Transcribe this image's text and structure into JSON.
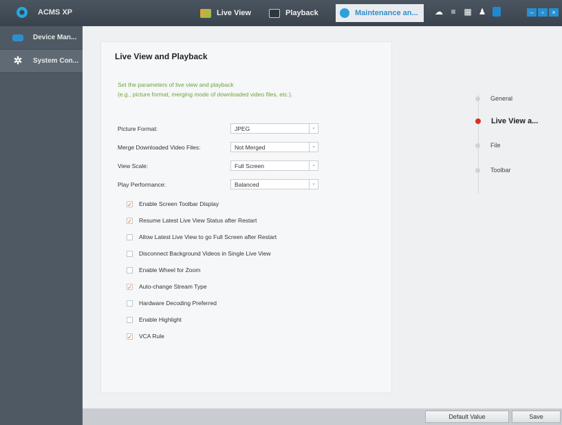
{
  "app": {
    "title": "ACMS XP"
  },
  "nav": {
    "tabs": [
      {
        "label": "Live View",
        "icon": "live-view-icon"
      },
      {
        "label": "Playback",
        "icon": "playback-icon"
      },
      {
        "label": "Maintenance an...",
        "icon": "maintenance-icon",
        "active": true
      }
    ]
  },
  "sidebar": {
    "items": [
      {
        "label": "Device Man...",
        "icon": "device-icon"
      },
      {
        "label": "System Con...",
        "icon": "gear-icon",
        "active": true
      }
    ]
  },
  "panel": {
    "title": "Live View and Playback",
    "description_line1": "Set the parameters of live view and playback",
    "description_line2": "(e.g., picture format, merging mode of downloaded video files, etc.).",
    "fields": [
      {
        "label": "Picture Format:",
        "value": "JPEG"
      },
      {
        "label": "Merge Downloaded Video Files:",
        "value": "Not Merged"
      },
      {
        "label": "View Scale:",
        "value": "Full Screen"
      },
      {
        "label": "Play Performance:",
        "value": "Balanced"
      }
    ],
    "checkboxes": [
      {
        "label": "Enable Screen Toolbar Display",
        "checked": true
      },
      {
        "label": "Resume Latest Live View Status after Restart",
        "checked": true
      },
      {
        "label": "Allow Latest Live View to go Full Screen after Restart",
        "checked": false
      },
      {
        "label": "Disconnect Background Videos in Single Live View",
        "checked": false
      },
      {
        "label": "Enable Wheel for Zoom",
        "checked": false
      },
      {
        "label": "Auto-change Stream Type",
        "checked": true
      },
      {
        "label": "Hardware Decoding Preferred",
        "checked": false
      },
      {
        "label": "Enable Highlight",
        "checked": false
      },
      {
        "label": "VCA Rule",
        "checked": true
      }
    ]
  },
  "steps": [
    {
      "label": "General"
    },
    {
      "label": "Live View a...",
      "active": true
    },
    {
      "label": "File"
    },
    {
      "label": "Toolbar"
    }
  ],
  "footer": {
    "default_label": "Default Value",
    "save_label": "Save"
  },
  "checkmark": "✓"
}
